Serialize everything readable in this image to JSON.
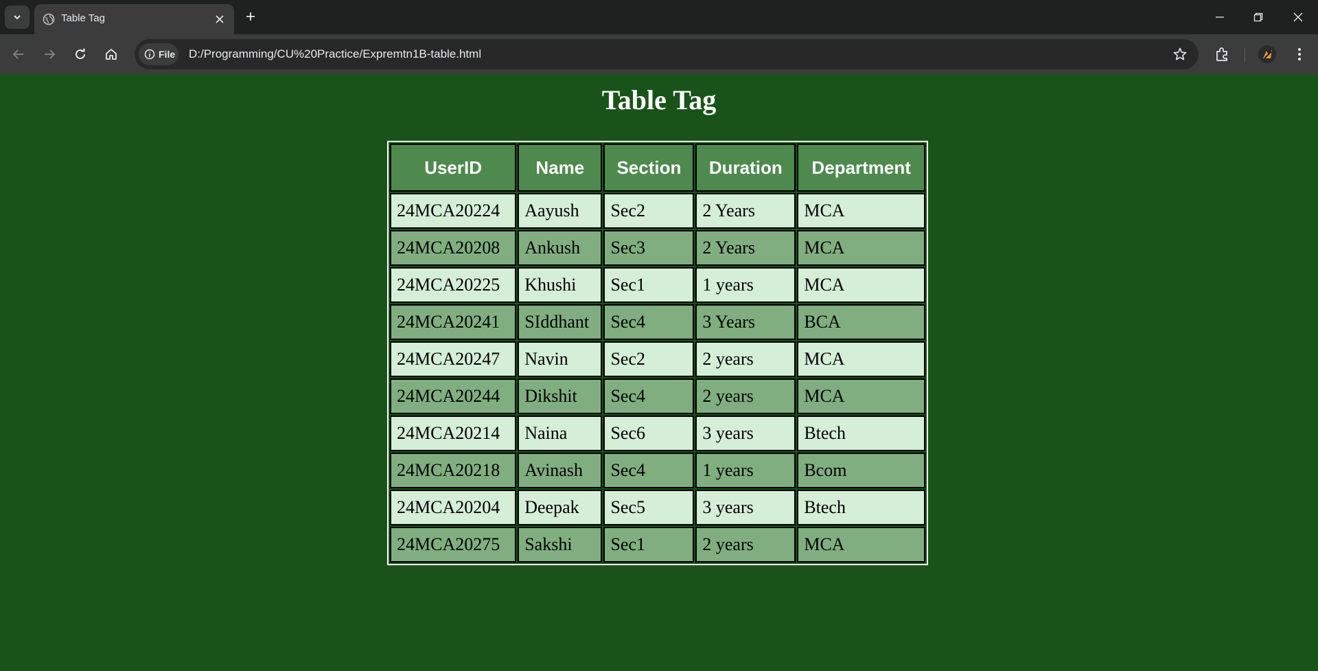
{
  "browser": {
    "tab_title": "Table Tag",
    "site_chip_label": "File",
    "url": "D:/Programming/CU%20Practice/Expremtn1B-table.html",
    "icons": [
      "tab-search-icon",
      "globe-icon",
      "close-icon",
      "plus-icon",
      "minimize-icon",
      "restore-icon",
      "close-window-icon",
      "back-arrow-icon",
      "forward-arrow-icon",
      "reload-icon",
      "home-icon",
      "info-icon",
      "star-icon",
      "extensions-icon",
      "profile-icon",
      "more-menu-icon"
    ]
  },
  "page": {
    "heading": "Table Tag",
    "table": {
      "headers": [
        "UserID",
        "Name",
        "Section",
        "Duration",
        "Department"
      ],
      "rows": [
        [
          "24MCA20224",
          "Aayush",
          "Sec2",
          "2 Years",
          "MCA"
        ],
        [
          "24MCA20208",
          "Ankush",
          "Sec3",
          "2 Years",
          "MCA"
        ],
        [
          "24MCA20225",
          "Khushi",
          "Sec1",
          "1 years",
          "MCA"
        ],
        [
          "24MCA20241",
          "SIddhant",
          "Sec4",
          "3 Years",
          "BCA"
        ],
        [
          "24MCA20247",
          "Navin",
          "Sec2",
          "2 years",
          "MCA"
        ],
        [
          "24MCA20244",
          "Dikshit",
          "Sec4",
          "2 years",
          "MCA"
        ],
        [
          "24MCA20214",
          "Naina",
          "Sec6",
          "3 years",
          "Btech"
        ],
        [
          "24MCA20218",
          "Avinash",
          "Sec4",
          "1 years",
          "Bcom"
        ],
        [
          "24MCA20204",
          "Deepak",
          "Sec5",
          "3 years",
          "Btech"
        ],
        [
          "24MCA20275",
          "Sakshi",
          "Sec1",
          "2 years",
          "MCA"
        ]
      ]
    }
  },
  "colors": {
    "page_background": "#1a531a",
    "header_cell": "#4e894e",
    "row_light": "#d5eed7",
    "row_dark": "#80ae80"
  }
}
